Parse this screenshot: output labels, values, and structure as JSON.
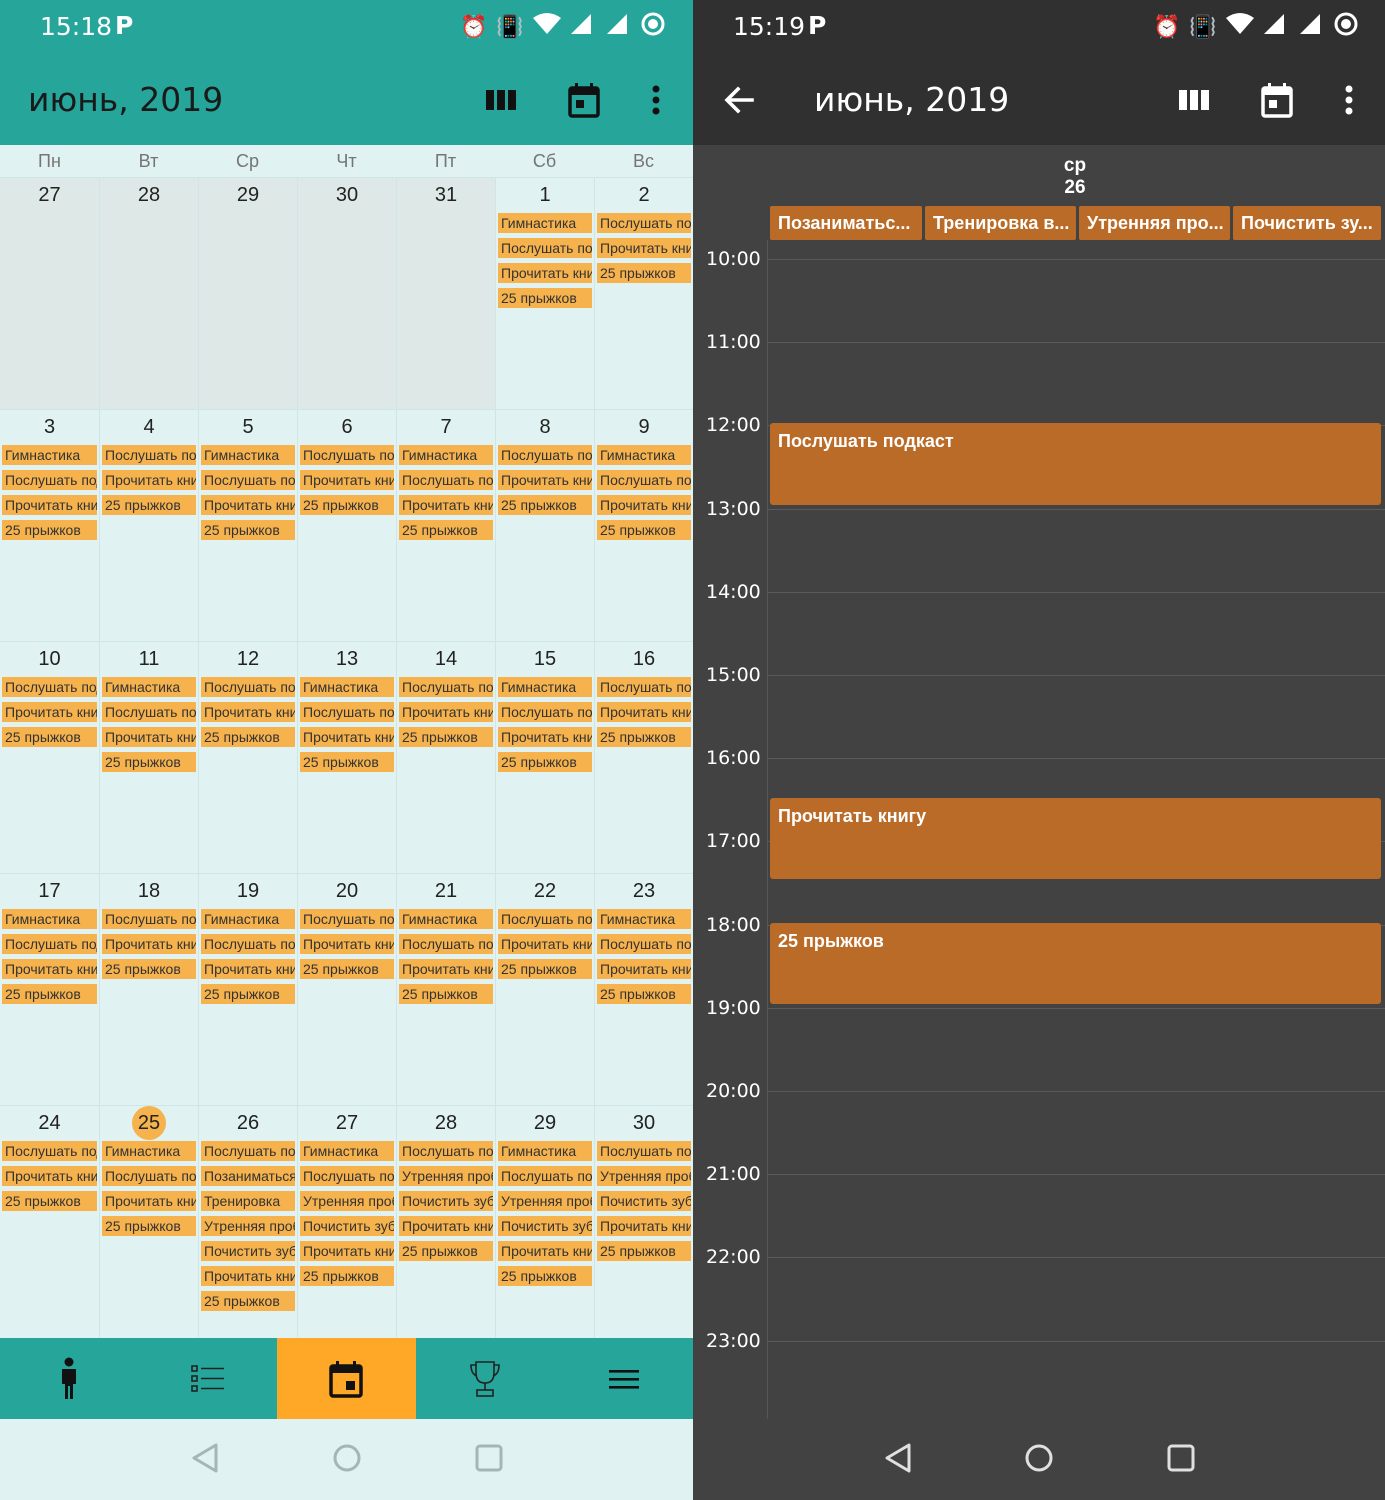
{
  "left": {
    "status": {
      "time": "15:18",
      "p": "P"
    },
    "title": "июнь, 2019",
    "weekdays": [
      "Пн",
      "Вт",
      "Ср",
      "Чт",
      "Пт",
      "Сб",
      "Вс"
    ],
    "weeks": [
      [
        {
          "d": "27",
          "other": true,
          "ev": []
        },
        {
          "d": "28",
          "other": true,
          "ev": []
        },
        {
          "d": "29",
          "other": true,
          "ev": []
        },
        {
          "d": "30",
          "other": true,
          "ev": []
        },
        {
          "d": "31",
          "other": true,
          "ev": []
        },
        {
          "d": "1",
          "ev": [
            "Гимнастика",
            "Послушать подкаст",
            "Прочитать книгу",
            "25 прыжков"
          ]
        },
        {
          "d": "2",
          "ev": [
            "Послушать подкаст",
            "Прочитать книгу",
            "25 прыжков"
          ]
        }
      ],
      [
        {
          "d": "3",
          "ev": [
            "Гимнастика",
            "Послушать подкаст",
            "Прочитать книгу",
            "25 прыжков"
          ]
        },
        {
          "d": "4",
          "ev": [
            "Послушать подкаст",
            "Прочитать книгу",
            "25 прыжков"
          ]
        },
        {
          "d": "5",
          "ev": [
            "Гимнастика",
            "Послушать подкаст",
            "Прочитать книгу",
            "25 прыжков"
          ]
        },
        {
          "d": "6",
          "ev": [
            "Послушать подкаст",
            "Прочитать книгу",
            "25 прыжков"
          ]
        },
        {
          "d": "7",
          "ev": [
            "Гимнастика",
            "Послушать подкаст",
            "Прочитать книгу",
            "25 прыжков"
          ]
        },
        {
          "d": "8",
          "ev": [
            "Послушать подкаст",
            "Прочитать книгу",
            "25 прыжков"
          ]
        },
        {
          "d": "9",
          "ev": [
            "Гимнастика",
            "Послушать подкаст",
            "Прочитать книгу",
            "25 прыжков"
          ]
        }
      ],
      [
        {
          "d": "10",
          "ev": [
            "Послушать подкаст",
            "Прочитать книгу",
            "25 прыжков"
          ]
        },
        {
          "d": "11",
          "ev": [
            "Гимнастика",
            "Послушать подкаст",
            "Прочитать книгу",
            "25 прыжков"
          ]
        },
        {
          "d": "12",
          "ev": [
            "Послушать подкаст",
            "Прочитать книгу",
            "25 прыжков"
          ]
        },
        {
          "d": "13",
          "ev": [
            "Гимнастика",
            "Послушать подкаст",
            "Прочитать книгу",
            "25 прыжков"
          ]
        },
        {
          "d": "14",
          "ev": [
            "Послушать подкаст",
            "Прочитать книгу",
            "25 прыжков"
          ]
        },
        {
          "d": "15",
          "ev": [
            "Гимнастика",
            "Послушать подкаст",
            "Прочитать книгу",
            "25 прыжков"
          ]
        },
        {
          "d": "16",
          "ev": [
            "Послушать подкаст",
            "Прочитать книгу",
            "25 прыжков"
          ]
        }
      ],
      [
        {
          "d": "17",
          "ev": [
            "Гимнастика",
            "Послушать подкаст",
            "Прочитать книгу",
            "25 прыжков"
          ]
        },
        {
          "d": "18",
          "ev": [
            "Послушать подкаст",
            "Прочитать книгу",
            "25 прыжков"
          ]
        },
        {
          "d": "19",
          "ev": [
            "Гимнастика",
            "Послушать подкаст",
            "Прочитать книгу",
            "25 прыжков"
          ]
        },
        {
          "d": "20",
          "ev": [
            "Послушать подкаст",
            "Прочитать книгу",
            "25 прыжков"
          ]
        },
        {
          "d": "21",
          "ev": [
            "Гимнастика",
            "Послушать подкаст",
            "Прочитать книгу",
            "25 прыжков"
          ]
        },
        {
          "d": "22",
          "ev": [
            "Послушать подкаст",
            "Прочитать книгу",
            "25 прыжков"
          ]
        },
        {
          "d": "23",
          "ev": [
            "Гимнастика",
            "Послушать подкаст",
            "Прочитать книгу",
            "25 прыжков"
          ]
        }
      ],
      [
        {
          "d": "24",
          "ev": [
            "Послушать подкаст",
            "Прочитать книгу",
            "25 прыжков"
          ]
        },
        {
          "d": "25",
          "today": true,
          "ev": [
            "Гимнастика",
            "Послушать подкаст",
            "Прочитать книгу",
            "25 прыжков"
          ]
        },
        {
          "d": "26",
          "ev": [
            "Послушать подкаст",
            "Позаниматься",
            "Тренировка",
            "Утренняя пробежка",
            "Почистить зубы",
            "Прочитать книгу",
            "25 прыжков"
          ]
        },
        {
          "d": "27",
          "ev": [
            "Гимнастика",
            "Послушать подкаст",
            "Утренняя пробежка",
            "Почистить зубы",
            "Прочитать книгу",
            "25 прыжков"
          ]
        },
        {
          "d": "28",
          "ev": [
            "Послушать подкаст",
            "Утренняя пробежка",
            "Почистить зубы",
            "Прочитать книгу",
            "25 прыжков"
          ]
        },
        {
          "d": "29",
          "ev": [
            "Гимнастика",
            "Послушать подкаст",
            "Утренняя пробежка",
            "Почистить зубы",
            "Прочитать книгу",
            "25 прыжков"
          ]
        },
        {
          "d": "30",
          "ev": [
            "Послушать подкаст",
            "Утренняя пробежка",
            "Почистить зубы",
            "Прочитать книгу",
            "25 прыжков"
          ]
        }
      ]
    ],
    "bottom_nav": [
      {
        "icon": "person-icon",
        "active": false
      },
      {
        "icon": "list-icon",
        "active": false
      },
      {
        "icon": "calendar-icon",
        "active": true
      },
      {
        "icon": "trophy-icon",
        "active": false
      },
      {
        "icon": "menu-icon",
        "active": false
      }
    ]
  },
  "right": {
    "status": {
      "time": "15:19",
      "p": "P"
    },
    "title": "июнь, 2019",
    "day_label": {
      "weekday": "ср",
      "date": "26"
    },
    "all_day": [
      "Позаниматьс...",
      "Тренировка в...",
      "Утренняя про...",
      "Почистить зу..."
    ],
    "hours": [
      "10:00",
      "11:00",
      "12:00",
      "13:00",
      "14:00",
      "15:00",
      "16:00",
      "17:00",
      "18:00",
      "19:00",
      "20:00",
      "21:00",
      "22:00",
      "23:00"
    ],
    "events": [
      {
        "title": "Послушать подкаст",
        "start": "12:00",
        "end": "13:00"
      },
      {
        "title": "Прочитать книгу",
        "start": "16:30",
        "end": "17:30"
      },
      {
        "title": "25 прыжков",
        "start": "18:00",
        "end": "19:00"
      }
    ]
  },
  "colors": {
    "teal": "#26a69a",
    "mint_bg": "#e0f2f1",
    "event_chip": "#f6b24c",
    "nav_active": "#ffa726",
    "dark_bg": "#424242",
    "dark_bar": "#303030",
    "dark_event": "#bb6b28"
  }
}
